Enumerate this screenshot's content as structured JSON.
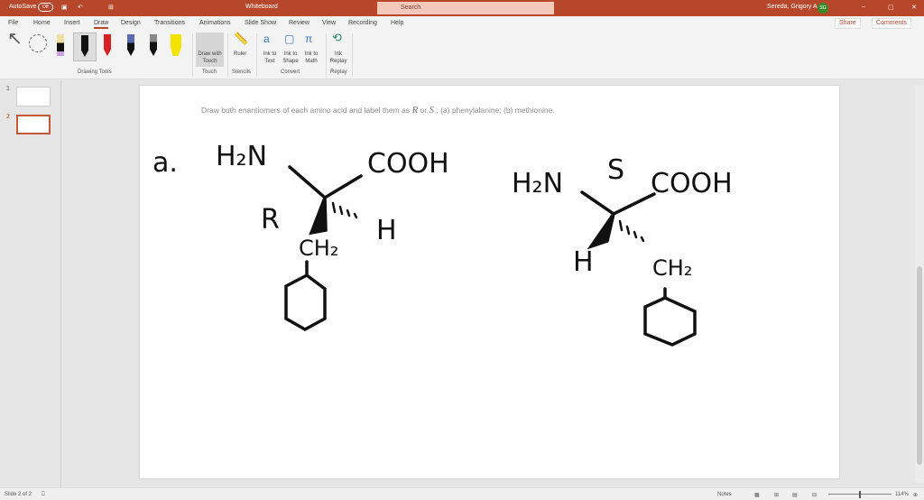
{
  "titlebar": {
    "autosave": "AutoSave",
    "autosave_state": "Off",
    "doc_title": "Whiteboard",
    "search_placeholder": "Search",
    "user": "Sereda, Grigory A",
    "initials": "SG"
  },
  "tabs": [
    "File",
    "Home",
    "Insert",
    "Draw",
    "Design",
    "Transitions",
    "Animations",
    "Slide Show",
    "Review",
    "View",
    "Recording",
    "Help"
  ],
  "active_tab": "Draw",
  "share": "Share",
  "comments": "Comments",
  "ribbon": {
    "drawing_tools": "Drawing Tools",
    "draw_touch": "Draw with Touch",
    "touch": "Touch",
    "ruler": "Ruler",
    "stencils": "Stencils",
    "ink_text": "Ink to Text",
    "ink_shape": "Ink to Shape",
    "ink_math": "Ink to Math",
    "convert": "Convert",
    "ink_replay": "Ink Replay",
    "replay": "Replay"
  },
  "thumbnails": [
    "1",
    "2"
  ],
  "slide": {
    "prompt_pre": "Draw both enantiomers of each amino acid and label them as",
    "R": "R",
    "or": "or",
    "S": "S",
    "prompt_post": ": (a) phenylalanine; (b) methionine.",
    "ink": {
      "a": "a.",
      "h2n": "H₂N",
      "cooh": "COOH",
      "r": "R",
      "h": "H",
      "ch2": "CH₂",
      "s": "S"
    }
  },
  "status": {
    "slide": "Slide 2 of 2",
    "notes": "Notes",
    "zoom": "114%"
  },
  "colors": {
    "accent": "#b7472a"
  }
}
